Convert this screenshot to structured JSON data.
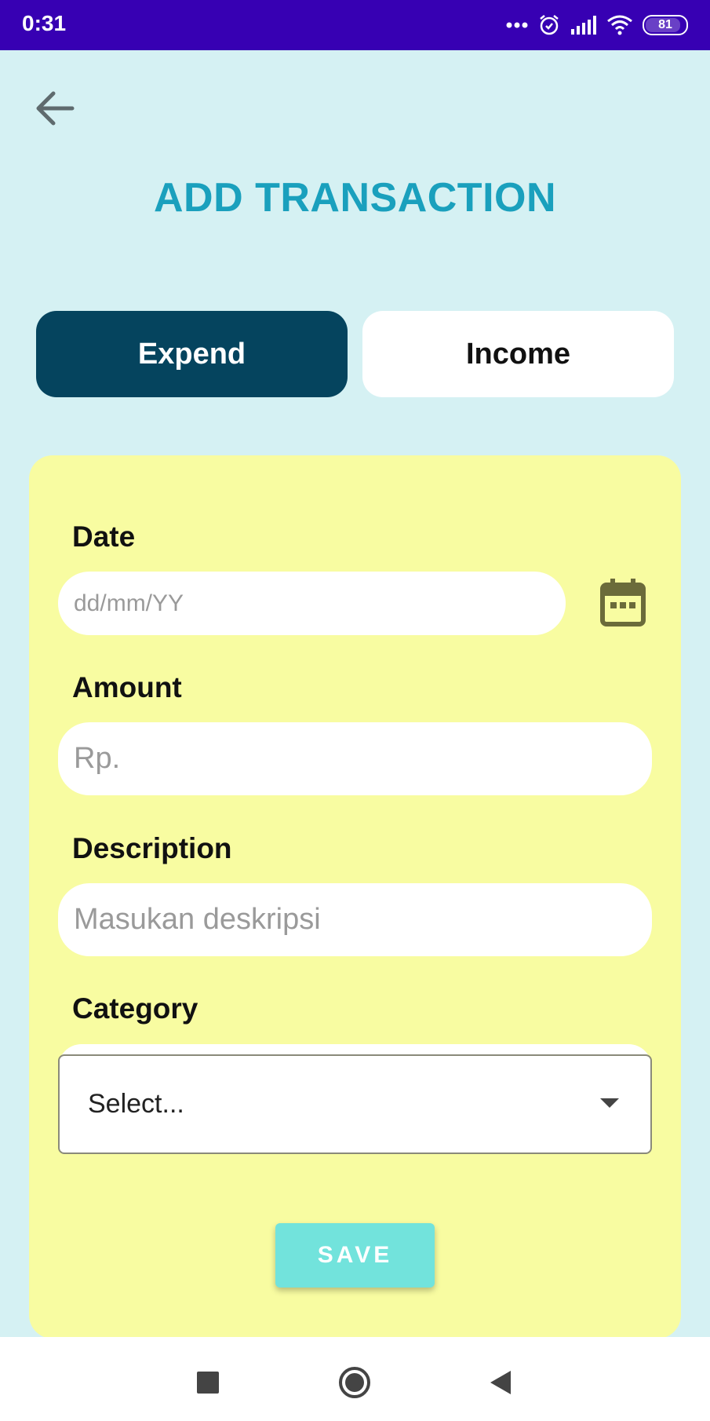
{
  "status_bar": {
    "time": "0:31",
    "battery_level": "81",
    "icons": [
      "more-dots-icon",
      "alarm-icon",
      "signal-icon",
      "wifi-icon",
      "battery-icon"
    ]
  },
  "header": {
    "back_icon": "arrow-left-icon",
    "title": "ADD TRANSACTION"
  },
  "type_toggle": {
    "options": [
      {
        "label": "Expend",
        "selected": true
      },
      {
        "label": "Income",
        "selected": false
      }
    ]
  },
  "form": {
    "date": {
      "label": "Date",
      "placeholder": "dd/mm/YY",
      "value": "",
      "icon": "calendar-icon"
    },
    "amount": {
      "label": "Amount",
      "placeholder": "Rp.",
      "value": ""
    },
    "description": {
      "label": "Description",
      "placeholder": "Masukan deskripsi",
      "value": ""
    },
    "category": {
      "label": "Category",
      "selected": "Select...",
      "icon": "caret-down-icon"
    },
    "save_label": "SAVE"
  },
  "nav_bar": {
    "icons": [
      "recents-square-icon",
      "home-circle-icon",
      "back-triangle-icon"
    ]
  },
  "colors": {
    "status_bar": "#3700b3",
    "background": "#d5f1f3",
    "title": "#1aa0bd",
    "selected_toggle": "#05445e",
    "card": "#f8fca1",
    "save_button": "#72e3dc",
    "calendar_icon": "#6b6b3a"
  }
}
